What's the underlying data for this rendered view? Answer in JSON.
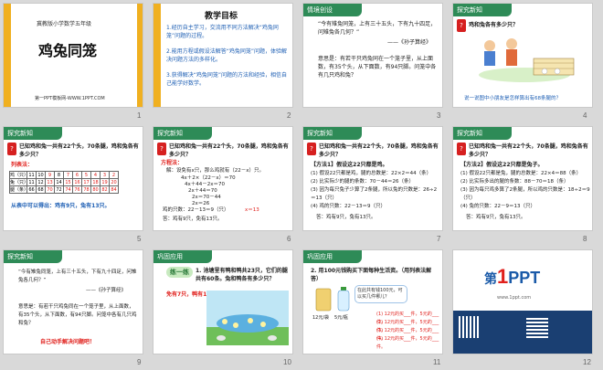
{
  "slide_numbers": [
    "1",
    "2",
    "3",
    "4",
    "5",
    "6",
    "7",
    "8",
    "9",
    "10",
    "11",
    "12"
  ],
  "s1": {
    "top": "冀教版小学数学五年级",
    "title": "鸡兔同笼",
    "footer": "第一PPT模板网-WWW.1PPT.COM"
  },
  "s2": {
    "heading": "教学目标",
    "items": [
      "1.经历自主学习，交流用不同方法解决“鸡兔同笼”问题的过程。",
      "2.能用方程或假设法解答“鸡兔同笼”问题，体验解决问题方法的多样化。",
      "3.获得解决“鸡兔同笼”问题的方法和经验，相信自己能学好数学。"
    ]
  },
  "s3": {
    "header": "情境创设",
    "quote": "“今有雉兔同笼，上有三十五头，下有九十四足，问雉兔各几何？”",
    "source": "——《孙子算经》",
    "explain": "意思是：有若干只鸡兔同在一个笼子里，从上面数，有35个头，从下面数，有94只脚。问笼中各有几只鸡和兔？"
  },
  "s4": {
    "header": "探究新知",
    "q": "鸡和兔各有多少只？",
    "bottom": "说一说图中小朋友是怎样算出有68条腿的？"
  },
  "s5": {
    "header": "探究新知",
    "q": "已知鸡和兔一共有22个头，70条腿，鸡和兔各有多少只？",
    "method": "列表法：",
    "rows": [
      [
        "鸡（只）",
        "11",
        "10",
        "9",
        "8",
        "7",
        "6",
        "5",
        "4",
        "3",
        "2"
      ],
      [
        "兔（只）",
        "11",
        "12",
        "13",
        "14",
        "15",
        "16",
        "17",
        "18",
        "19",
        "20"
      ],
      [
        "腿（条）",
        "66",
        "68",
        "70",
        "72",
        "74",
        "76",
        "78",
        "80",
        "82",
        "84"
      ]
    ],
    "answer": "从表中可以得出：鸡有9只，兔有13只。"
  },
  "s6": {
    "header": "探究新知",
    "q": "已知鸡和兔一共有22个头，70条腿，鸡和兔各有多少只？",
    "method": "方程法：",
    "lines": [
      "解：设免有x只，那么鸡就有（22－x）只。",
      "4x＋2×（22－x）＝70",
      "4x＋44－2x＝70",
      "2x＋44＝70",
      "2x＝70－44",
      "2x＝26",
      "x＝13",
      "鸡的只数：22－13＝9（只）",
      "答：鸡有9只，免有13只。"
    ]
  },
  "s7": {
    "header": "探究新知",
    "q": "已知鸡和兔一共有22个头，70条腿，鸡和兔各有多少只？",
    "method": "【方法1】假设这22只都是鸡。",
    "lines": [
      "(1) 假设22只都是鸡，腿的总数是：22×2＝44（条）",
      "(2) 比实际少的腿的条数：70－44＝26（条）",
      "(3) 因为每只兔子少算了2条腿，所以兔的只数是：26÷2＝13（只）",
      "(4) 鸡的只数：22－13＝9（只）",
      "答：鸡有9只，兔有13只。"
    ]
  },
  "s8": {
    "header": "探究新知",
    "q": "已知鸡和兔一共有22个头，70条腿，鸡和兔各有多少只？",
    "method": "【方法2】假设这22只都是兔子。",
    "lines": [
      "(1) 假设22只都是兔，腿的总数是：22×4＝88（条）",
      "(2) 比实际多出的腿的条数：88－70＝18（条）",
      "(3) 因为每只鸡多算了2条腿，所以鸡的只数是：18÷2＝9（只）",
      "(4) 兔的只数：22－9＝13（只）",
      "答：鸡有9只，兔有13只。"
    ]
  },
  "s9": {
    "header": "探究新知",
    "quote": "“今有雉兔同笼，上有三十五头，下有九十四足，问雉兔各几何？”",
    "source": "——《孙子算经》",
    "explain": "意思是：有若干只鸡兔同在一个笼子里，从上面数，有35个头，从下面数，有94只脚。问笼中各有几只鸡和兔？",
    "action": "自己动手解决问题吧！"
  },
  "s10": {
    "header": "巩固应用",
    "badge": "练一练",
    "q": "1. 池塘里有鸭和鸭共23只，它们的腿共有60条。兔和鸭各有多少只？",
    "answer": "免有7只，鸭有16只。"
  },
  "s11": {
    "header": "巩固应用",
    "q": "2. 用100元钱购买下面每种生活资。（用列表法解答）",
    "bubble": "在此共有钱100元，可以买几件哪儿？",
    "items": [
      "(1) 12元的买___件，5元的___件。",
      "(2) 12元的买___件，5元的___件。",
      "(3) 12元的买___件，5元的___件。",
      "(4) 12元的买___件，5元的___件。"
    ],
    "labels": [
      "12元/袋",
      "5元/瓶"
    ]
  },
  "s12": {
    "logo_small": "第",
    "logo_big": "1",
    "logo_text": "PPT",
    "url": "www.1ppt.com"
  }
}
